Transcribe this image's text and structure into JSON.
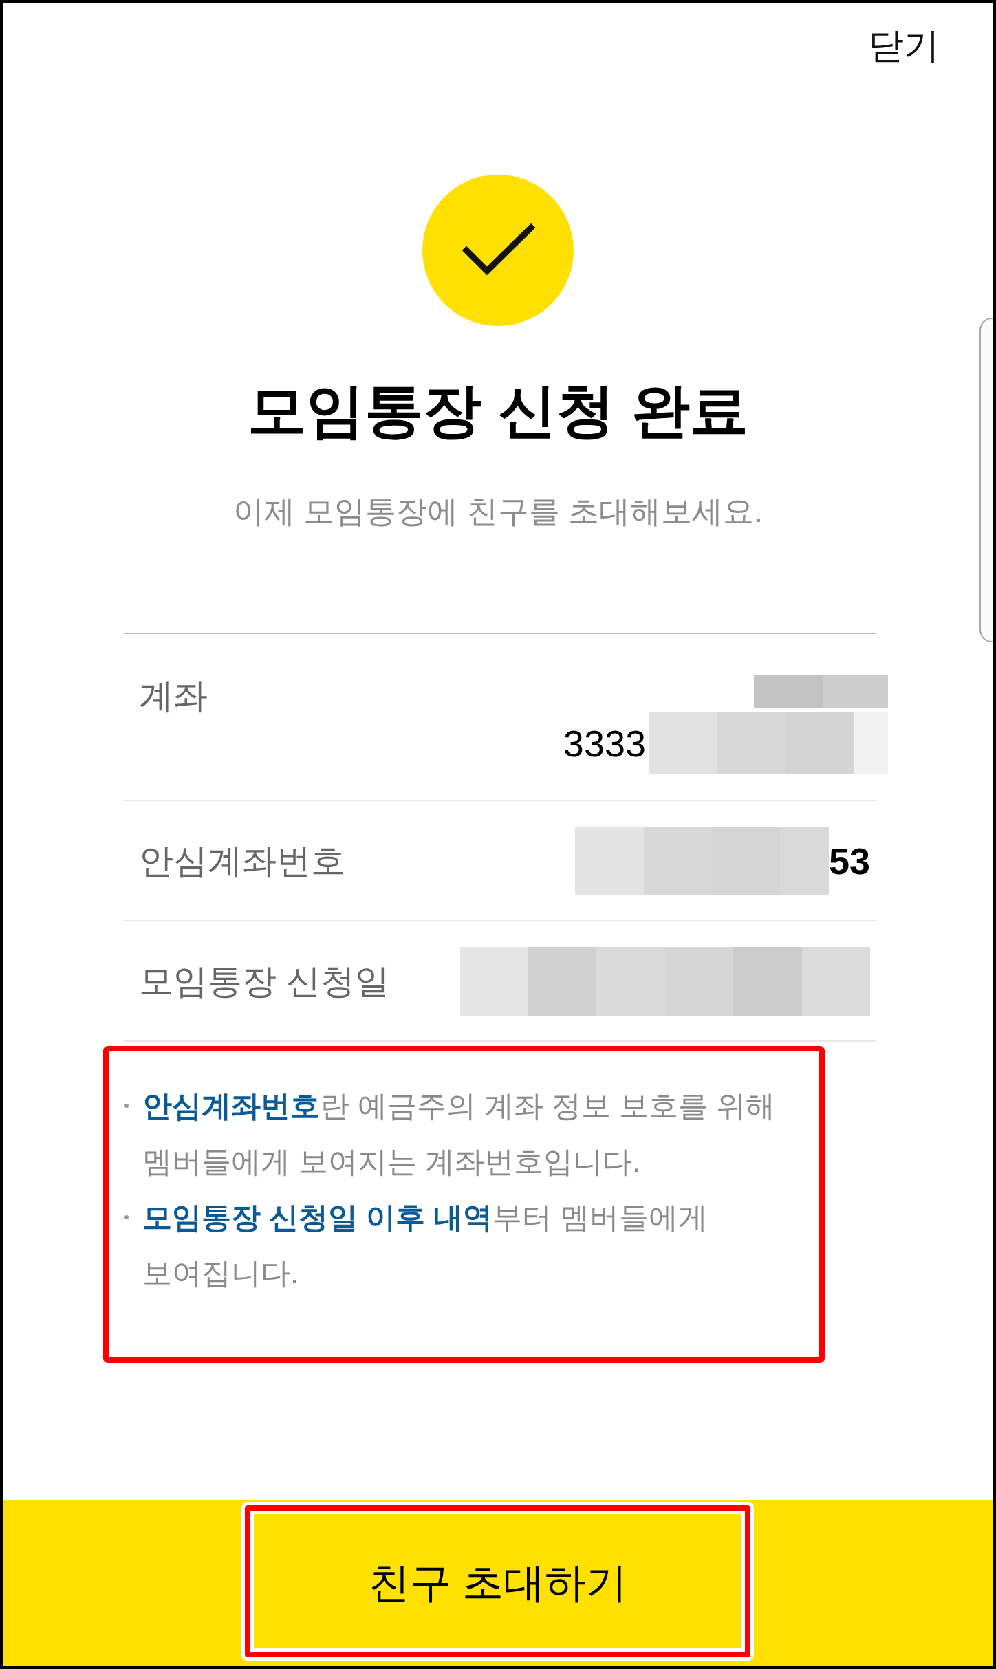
{
  "close_button": "닫기",
  "success_title": "모임통장 신청 완료",
  "subtitle": "이제 모임통장에 친구를 초대해보세요.",
  "details": [
    {
      "label": "계좌",
      "value_lines": [
        [
          {
            "kind": "redacted"
          }
        ],
        [
          {
            "kind": "text",
            "text": "3333"
          },
          {
            "kind": "redacted"
          }
        ]
      ]
    },
    {
      "label": "안심계좌번호",
      "value_lines": [
        [
          {
            "kind": "redacted"
          },
          {
            "kind": "bold_text",
            "text": "53"
          }
        ]
      ]
    },
    {
      "label": "모임통장 신청일",
      "value_lines": [
        [
          {
            "kind": "redacted"
          }
        ]
      ]
    }
  ],
  "notes": [
    "**안심계좌번호**란 예금주의 계좌 정보 보호를 위해 멤버들에게 보여지는 계좌번호입니다.",
    "**모임통장 신청일 이후 내역**부터 멤버들에게 보여집니다."
  ],
  "primary_button": "친구 초대하기"
}
